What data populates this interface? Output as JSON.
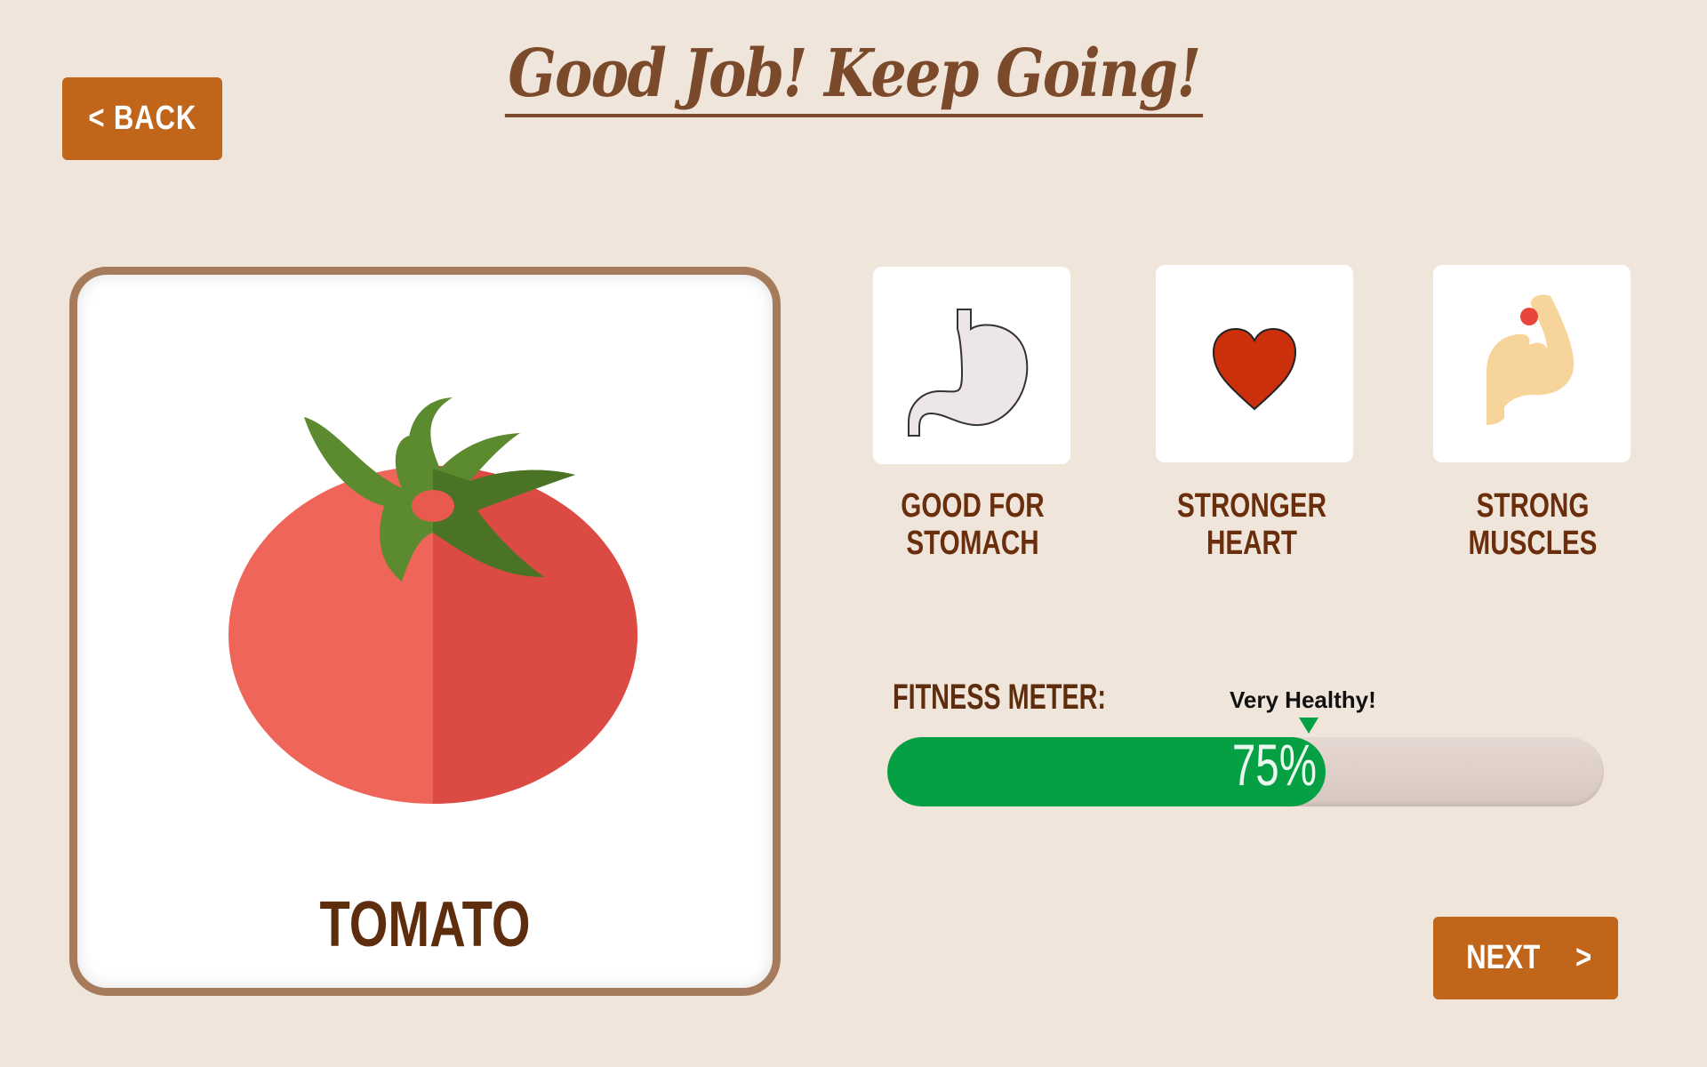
{
  "header": {
    "title": "Good Job! Keep Going!",
    "back_label": "< BACK"
  },
  "food": {
    "name": "TOMATO",
    "image_icon": "tomato-icon"
  },
  "benefits": [
    {
      "label": "GOOD FOR\nSTOMACH",
      "icon": "stomach-icon"
    },
    {
      "label": "STRONGER HEART",
      "icon": "heart-icon"
    },
    {
      "label": "STRONG\nMUSCLES",
      "icon": "muscle-arm-icon"
    }
  ],
  "meter": {
    "label": "FITNESS METER:",
    "percent": 75,
    "value_text": "75%",
    "marker_text": "Very Healthy!",
    "fill_color": "#04a043"
  },
  "footer": {
    "next_label": "NEXT",
    "next_arrow": ">"
  },
  "colors": {
    "background": "#f0e5da",
    "button": "#c0651a",
    "title": "#7a4a2a",
    "card_border": "#a67b5b",
    "label_text": "#6a2e0c"
  }
}
